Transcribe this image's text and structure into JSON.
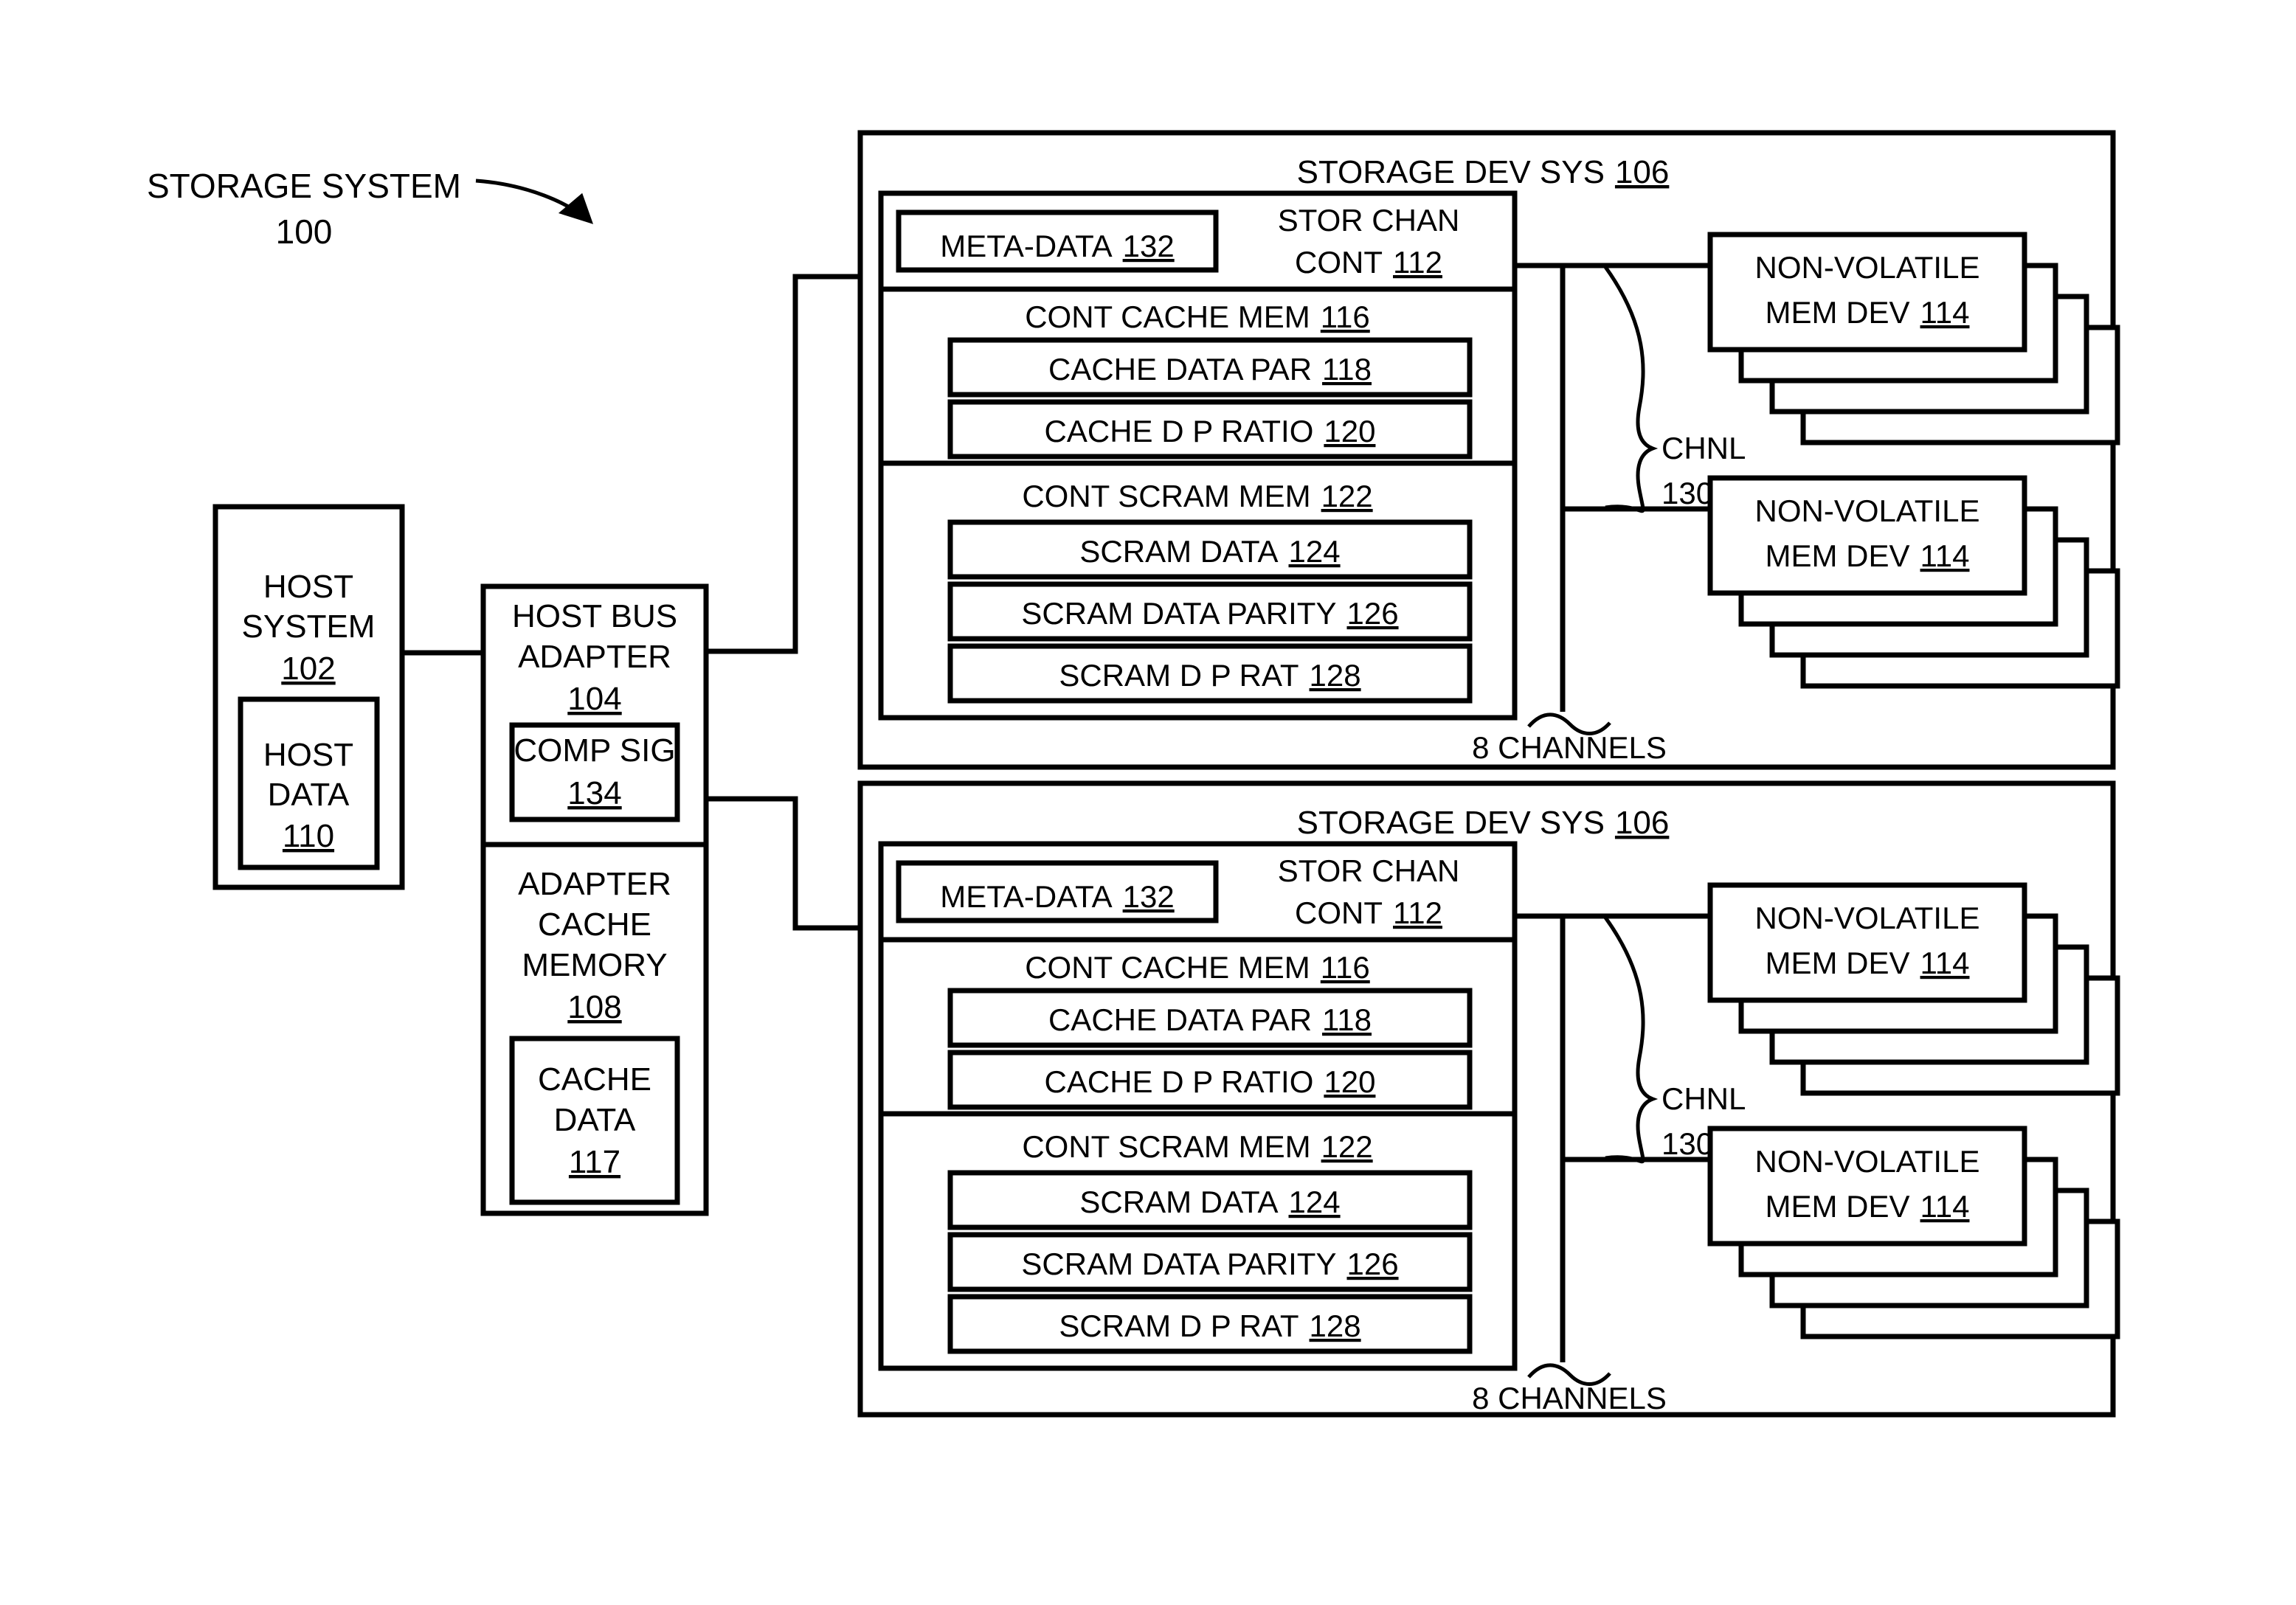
{
  "figure": {
    "title_label": "STORAGE SYSTEM",
    "title_ref": "100"
  },
  "host_system": {
    "line1": "HOST",
    "line2": "SYSTEM",
    "ref": "102",
    "host_data": {
      "line1": "HOST",
      "line2": "DATA",
      "ref": "110"
    }
  },
  "host_bus_adapter": {
    "line1": "HOST BUS",
    "line2": "ADAPTER",
    "ref": "104",
    "comp_sig": {
      "label": "COMP SIG",
      "ref": "134"
    },
    "adapter_cache_memory": {
      "line1": "ADAPTER",
      "line2": "CACHE",
      "line3": "MEMORY",
      "ref": "108",
      "cache_data": {
        "line1": "CACHE",
        "line2": "DATA",
        "ref": "117"
      }
    }
  },
  "storage_dev_systems": [
    {
      "title": "STORAGE DEV SYS",
      "ref": "106",
      "storage_channel_controller": {
        "line1": "STOR CHAN",
        "line2": "CONT",
        "ref": "112",
        "meta_data": {
          "label": "META-DATA",
          "ref": "132"
        }
      },
      "cont_cache_mem": {
        "label": "CONT CACHE MEM",
        "ref": "116",
        "rows": [
          {
            "label": "CACHE DATA PAR",
            "ref": "118"
          },
          {
            "label": "CACHE D P RATIO",
            "ref": "120"
          }
        ]
      },
      "cont_scram_mem": {
        "label": "CONT SCRAM MEM",
        "ref": "122",
        "rows": [
          {
            "label": "SCRAM DATA",
            "ref": "124"
          },
          {
            "label": "SCRAM DATA PARITY",
            "ref": "126"
          },
          {
            "label": "SCRAM D P RAT",
            "ref": "128"
          }
        ]
      },
      "channel": {
        "label": "CHNL",
        "ref": "130",
        "count_note": "8 CHANNELS"
      },
      "nvm_groups": [
        {
          "line1": "NON-VOLATILE",
          "line2": "MEM DEV",
          "ref": "114",
          "stack_count": 4
        },
        {
          "line1": "NON-VOLATILE",
          "line2": "MEM DEV",
          "ref": "114",
          "stack_count": 4
        }
      ]
    },
    {
      "title": "STORAGE DEV SYS",
      "ref": "106",
      "storage_channel_controller": {
        "line1": "STOR CHAN",
        "line2": "CONT",
        "ref": "112",
        "meta_data": {
          "label": "META-DATA",
          "ref": "132"
        }
      },
      "cont_cache_mem": {
        "label": "CONT CACHE MEM",
        "ref": "116",
        "rows": [
          {
            "label": "CACHE DATA PAR",
            "ref": "118"
          },
          {
            "label": "CACHE D P RATIO",
            "ref": "120"
          }
        ]
      },
      "cont_scram_mem": {
        "label": "CONT SCRAM MEM",
        "ref": "122",
        "rows": [
          {
            "label": "SCRAM DATA",
            "ref": "124"
          },
          {
            "label": "SCRAM DATA PARITY",
            "ref": "126"
          },
          {
            "label": "SCRAM D P RAT",
            "ref": "128"
          }
        ]
      },
      "channel": {
        "label": "CHNL",
        "ref": "130",
        "count_note": "8 CHANNELS"
      },
      "nvm_groups": [
        {
          "line1": "NON-VOLATILE",
          "line2": "MEM DEV",
          "ref": "114",
          "stack_count": 4
        },
        {
          "line1": "NON-VOLATILE",
          "line2": "MEM DEV",
          "ref": "114",
          "stack_count": 4
        }
      ]
    }
  ],
  "colors": {
    "ink": "#000000",
    "paper": "#ffffff"
  }
}
